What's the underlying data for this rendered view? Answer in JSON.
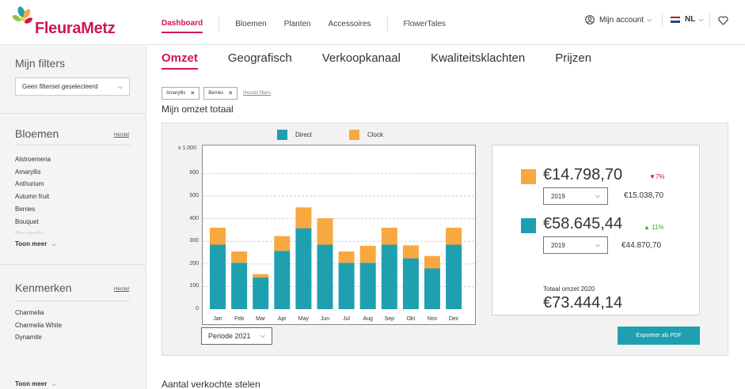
{
  "header": {
    "logo_text": "FleuraMetz",
    "nav": [
      {
        "label": "Dashboard",
        "active": true
      },
      {
        "label": "Bloemen"
      },
      {
        "label": "Planten"
      },
      {
        "label": "Accessoires"
      },
      {
        "label": "FlowerTales"
      }
    ],
    "account_label": "Mijn account",
    "language": "NL"
  },
  "sidebar": {
    "filters_title": "Mijn filters",
    "filterset_placeholder": "Geen filterset geselecteerd",
    "flowers": {
      "title": "Bloemen",
      "reset": "Herstel",
      "items": [
        "Alstroemeria",
        "Amaryllis",
        "Anthurium",
        "Autumn fruit",
        "Berries",
        "Bouquet",
        "Bouvardia"
      ],
      "more": "Toon meer"
    },
    "features": {
      "title": "Kenmerken",
      "reset": "Herstel",
      "items": [
        "Charmelia",
        "Charmelia White",
        "Dynamite"
      ],
      "more": "Toon meer"
    }
  },
  "main": {
    "tabs": [
      {
        "label": "Omzet",
        "active": true
      },
      {
        "label": "Geografisch"
      },
      {
        "label": "Verkoopkanaal"
      },
      {
        "label": "Kwaliteitsklachten"
      },
      {
        "label": "Prijzen"
      }
    ],
    "chips": [
      "Amaryllis",
      "Berries"
    ],
    "reset_filters": "Herstel filters",
    "section_title": "Mijn omzet totaal",
    "next_section_title": "Aantal verkochte stelen",
    "period_select": "Periode 2021",
    "export_button": "Exporteer als PDF"
  },
  "kpis": {
    "clock": {
      "amount": "€14.798,70",
      "delta": "7%",
      "delta_dir": "down",
      "year": "2019",
      "prev": "€15.038,70"
    },
    "direct": {
      "amount": "€58.645,44",
      "delta": "11%",
      "delta_dir": "up",
      "year": "2019",
      "prev": "€44.870,70"
    },
    "total_label": "Totaal omzet 2020",
    "total_amount": "€73.444,14"
  },
  "colors": {
    "brand": "#d1174e",
    "direct": "#1fa0b0",
    "clock": "#f7a83f",
    "down": "#c8103e",
    "up": "#3aa63a",
    "export": "#1fa0b0"
  },
  "chart_data": {
    "type": "bar",
    "stacked": true,
    "y_unit_label": "x 1.000",
    "categories": [
      "Jan",
      "Feb",
      "Mar",
      "Apr",
      "May",
      "Jun",
      "Jul",
      "Aug",
      "Sep",
      "Okt",
      "Nov",
      "Dec"
    ],
    "series": [
      {
        "name": "Direct",
        "values": [
          285,
          205,
          140,
          258,
          358,
          285,
          205,
          205,
          285,
          225,
          180,
          285
        ]
      },
      {
        "name": "Clock",
        "values": [
          75,
          50,
          15,
          65,
          92,
          117,
          50,
          75,
          75,
          57,
          55,
          75
        ]
      }
    ],
    "ylim": [
      0,
      700
    ],
    "yticks": [
      0,
      100,
      200,
      300,
      400,
      500,
      600
    ],
    "grid": true,
    "legend": "top-center"
  }
}
